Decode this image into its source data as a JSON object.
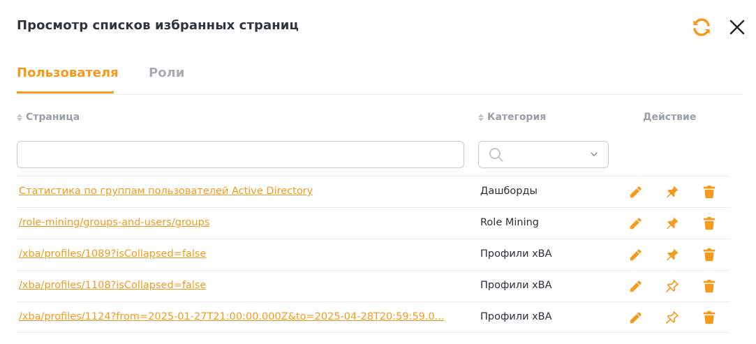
{
  "dialog": {
    "title": "Просмотр списков избранных страниц",
    "refresh_icon": "refresh-icon",
    "close_icon": "close-icon"
  },
  "tabs": [
    {
      "label": "Пользователя",
      "active": true
    },
    {
      "label": "Роли",
      "active": false
    }
  ],
  "columns": {
    "page": "Страница",
    "category": "Категория",
    "action": "Действие"
  },
  "filters": {
    "page_value": "",
    "category_value": ""
  },
  "rows": [
    {
      "page": "Статистика по группам пользователей Active Directory",
      "category": "Дашборды",
      "pinned": true
    },
    {
      "page": "/role-mining/groups-and-users/groups",
      "category": "Role Mining",
      "pinned": true
    },
    {
      "page": "/xba/profiles/1089?isCollapsed=false",
      "category": "Профили xBA",
      "pinned": true
    },
    {
      "page": "/xba/profiles/1108?isCollapsed=false",
      "category": "Профили xBA",
      "pinned": false
    },
    {
      "page": "/xba/profiles/1124?from=2025-01-27T21:00:00.000Z&to=2025-04-28T20:59:59.0...",
      "category": "Профили xBA",
      "pinned": false
    }
  ],
  "colors": {
    "accent": "#f59a1c",
    "text": "#2b2f36",
    "muted": "#9aa0a8",
    "border": "#ececec"
  }
}
